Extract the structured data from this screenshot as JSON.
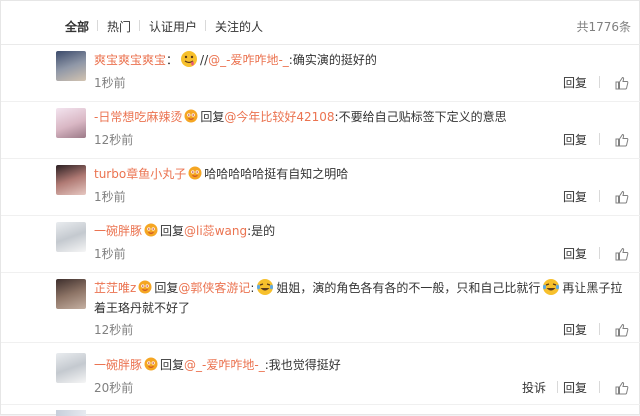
{
  "tabs": {
    "items": [
      {
        "label": "全部"
      },
      {
        "label": "热门"
      },
      {
        "label": "认证用户"
      },
      {
        "label": "关注的人"
      }
    ],
    "total_count": "共1776条"
  },
  "comments": [
    {
      "username": "爽宝爽宝爽宝",
      "separator": "：",
      "prefix": "//",
      "mention": "@_-爱咋咋地-_",
      "text": ":确实演的挺好的",
      "time": "1秒前",
      "reply": "回复",
      "avatar_icon": "user-avatar"
    },
    {
      "username": "-日常想吃麻辣烫",
      "reply_prefix": "回复",
      "mention": "@今年比较好42108",
      "text": ":不要给自己贴标签下定义的意思",
      "time": "12秒前",
      "reply": "回复",
      "avatar_icon": "user-avatar"
    },
    {
      "username": "turbo章鱼小丸子",
      "text": "哈哈哈哈哈挺有自知之明哈",
      "time": "1秒前",
      "reply": "回复",
      "avatar_icon": "user-avatar"
    },
    {
      "username": "一碗胖豚",
      "reply_prefix": "回复",
      "mention": "@li蕊wang",
      "text": ":是的",
      "time": "1秒前",
      "reply": "回复",
      "avatar_icon": "user-avatar"
    },
    {
      "username": "芷茳唯z",
      "reply_prefix": "回复",
      "mention": "@郭侠客游记",
      "text_part1": ":",
      "text_part2": "姐姐，演的角色各有各的不一般，只和自己比就行",
      "text_part3": "再让黑子拉着王珞丹就不好了",
      "time": "12秒前",
      "reply": "回复",
      "avatar_icon": "user-avatar"
    },
    {
      "username": "一碗胖豚",
      "reply_prefix": "回复",
      "mention": "@_-爱咋咋地-_",
      "text": ":我也觉得挺好",
      "time": "20秒前",
      "report": "投诉",
      "reply": "回复",
      "avatar_icon": "user-avatar"
    }
  ],
  "colors": {
    "username": "#eb7350",
    "muted": "#808080",
    "text": "#333333"
  },
  "icons": {
    "badge": "vip-badge-icon",
    "like": "thumbs-up-icon",
    "emoji_drool": "drooling-face-emoji",
    "emoji_laugh": "laughing-tears-emoji"
  }
}
